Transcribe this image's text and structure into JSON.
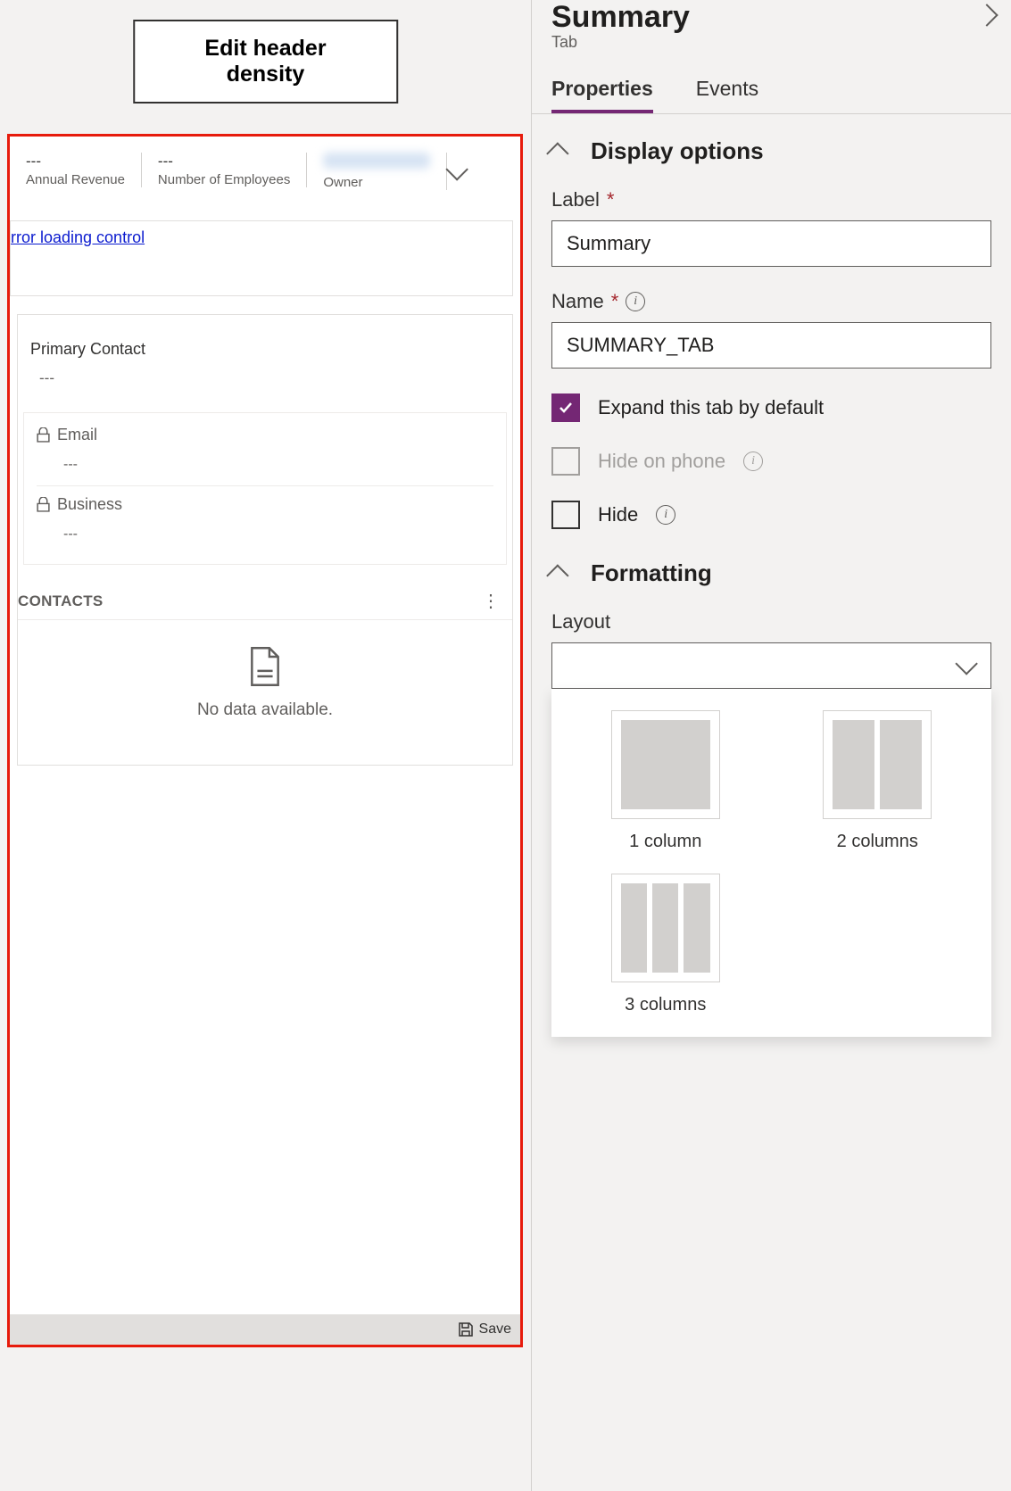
{
  "left": {
    "edit_button": "Edit header density",
    "header": {
      "revenue_val": "---",
      "revenue_lbl": "Annual Revenue",
      "employees_val": "---",
      "employees_lbl": "Number of Employees",
      "owner_lbl": "Owner"
    },
    "error_link": "rror loading control",
    "primary_contact_lbl": "Primary Contact",
    "primary_contact_val": "---",
    "email_lbl": "Email",
    "email_val": "---",
    "business_lbl": "Business",
    "business_val": "---",
    "contacts_title": "CONTACTS",
    "no_data": "No data available.",
    "save": "Save"
  },
  "panel": {
    "title": "Summary",
    "subtitle": "Tab",
    "tabs": {
      "properties": "Properties",
      "events": "Events"
    },
    "display": {
      "heading": "Display options",
      "label_lbl": "Label",
      "label_val": "Summary",
      "name_lbl": "Name",
      "name_val": "SUMMARY_TAB",
      "expand_lbl": "Expand this tab by default",
      "hide_phone_lbl": "Hide on phone",
      "hide_lbl": "Hide"
    },
    "formatting": {
      "heading": "Formatting",
      "layout_lbl": "Layout",
      "options": {
        "one": "1 column",
        "two": "2 columns",
        "three": "3 columns"
      }
    }
  }
}
